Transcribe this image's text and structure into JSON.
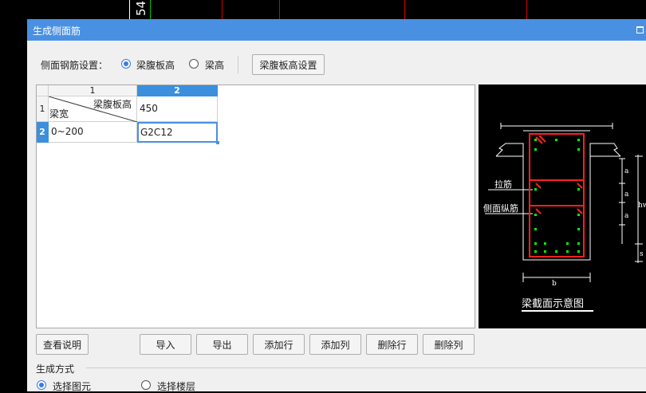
{
  "cad": {
    "number": "54"
  },
  "dialog": {
    "title": "生成侧面筋"
  },
  "settings": {
    "label": "侧面钢筋设置：",
    "options": [
      {
        "label": "梁腹板高",
        "selected": true
      },
      {
        "label": "梁高",
        "selected": false
      }
    ],
    "config_button": "梁腹板高设置"
  },
  "grid": {
    "col_headers": [
      "1",
      "2"
    ],
    "row_headers": [
      "1",
      "2"
    ],
    "corner_top": "梁腹板高",
    "corner_bottom": "梁宽",
    "rows": [
      {
        "col2": "450"
      },
      {
        "col1": "0~200",
        "col2": "G2C12"
      }
    ]
  },
  "diagram": {
    "label_tie": "拉筋",
    "label_side": "侧面纵筋",
    "label_a1": "a",
    "label_a2": "a",
    "label_a3": "a",
    "label_hw": "hw",
    "label_s": "s",
    "label_b": "b",
    "caption": "梁截面示意图"
  },
  "buttons": {
    "view_help": "查看说明",
    "import": "导入",
    "export": "导出",
    "add_row": "添加行",
    "add_col": "添加列",
    "delete_row": "删除行",
    "delete_col": "删除列"
  },
  "generate": {
    "heading": "生成方式",
    "options": [
      {
        "label": "选择图元",
        "selected": true
      },
      {
        "label": "选择楼层",
        "selected": false
      }
    ]
  },
  "colors": {
    "titlebar": "#4a90e2",
    "accent": "#3b8fdd",
    "rebar": "#ff2020",
    "dots": "#00ff00"
  }
}
